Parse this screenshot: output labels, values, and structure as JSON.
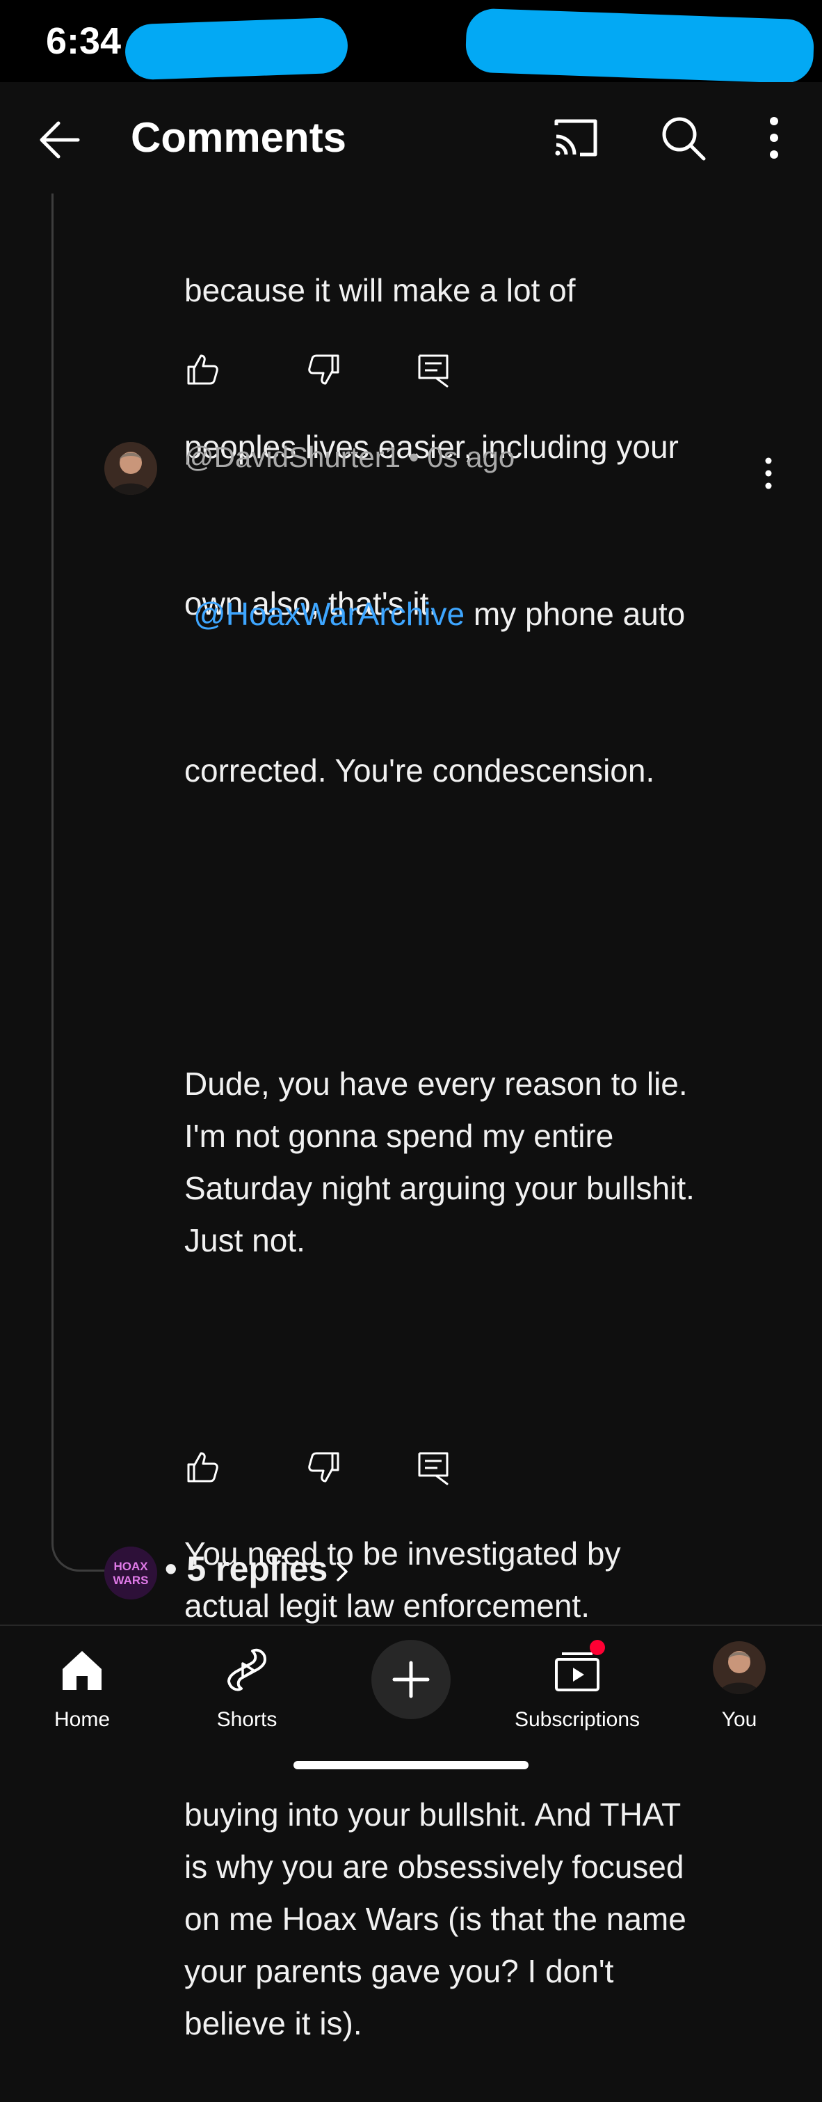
{
  "status_bar": {
    "time": "6:34"
  },
  "header": {
    "title": "Comments",
    "back_icon": "arrow-left-icon",
    "cast_icon": "cast-icon",
    "search_icon": "search-icon",
    "more_icon": "more-vert-icon"
  },
  "prev_comment": {
    "lines": [
      "because it will make a lot of",
      "peoples lives easier, including your",
      "own also, that's it."
    ]
  },
  "reply": {
    "author": "@DavidShurter1",
    "separator": "•",
    "time": "0s ago",
    "mention": "@HoaxWarArchive",
    "first_line_rest": " my phone auto",
    "paragraph1_line2": "corrected. You're condescension.",
    "paragraph2": "Dude, you have every reason to lie.\nI'm not gonna spend my entire\nSaturday night arguing your bullshit.\nJust not.",
    "paragraph3": "You need to be investigated by\nactual legit law enforcement.\nPolicing yourselves is bullshit. And\nevery liar claims they aren't a liar.\nBut I'm not the only one who isn't\nbuying into your bullshit. And THAT\nis why you are obsessively focused\non me Hoax Wars (is that the name\nyour parents gave you? I don't\nbelieve it is)."
  },
  "replies_link": {
    "avatar_text": "HOAX WARS",
    "separator": "•",
    "label": "5 replies"
  },
  "bottom_nav": {
    "items": [
      {
        "label": "Home",
        "icon": "home-icon"
      },
      {
        "label": "Shorts",
        "icon": "shorts-icon"
      },
      {
        "label": "",
        "icon": "plus-icon"
      },
      {
        "label": "Subscriptions",
        "icon": "subscriptions-icon"
      },
      {
        "label": "You",
        "icon": "avatar"
      }
    ]
  },
  "colors": {
    "background": "#0f0f0f",
    "text": "#f1f1f1",
    "secondary_text": "#aaaaaa",
    "mention": "#3ea6ff",
    "notification_dot": "#ff0033",
    "redaction": "#03a9f4"
  }
}
